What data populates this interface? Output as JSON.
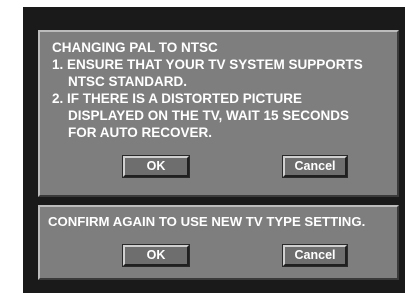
{
  "dialog1": {
    "title": "CHANGING PAL TO NTSC",
    "lines": [
      "1. ENSURE THAT YOUR TV SYSTEM SUPPORTS",
      "NTSC STANDARD.",
      "2. IF THERE IS A DISTORTED PICTURE",
      "DISPLAYED ON THE TV, WAIT 15 SECONDS",
      "FOR AUTO RECOVER."
    ],
    "ok_label": "OK",
    "cancel_label": "Cancel"
  },
  "dialog2": {
    "message": "CONFIRM AGAIN TO USE NEW TV TYPE SETTING.",
    "ok_label": "OK",
    "cancel_label": "Cancel"
  }
}
